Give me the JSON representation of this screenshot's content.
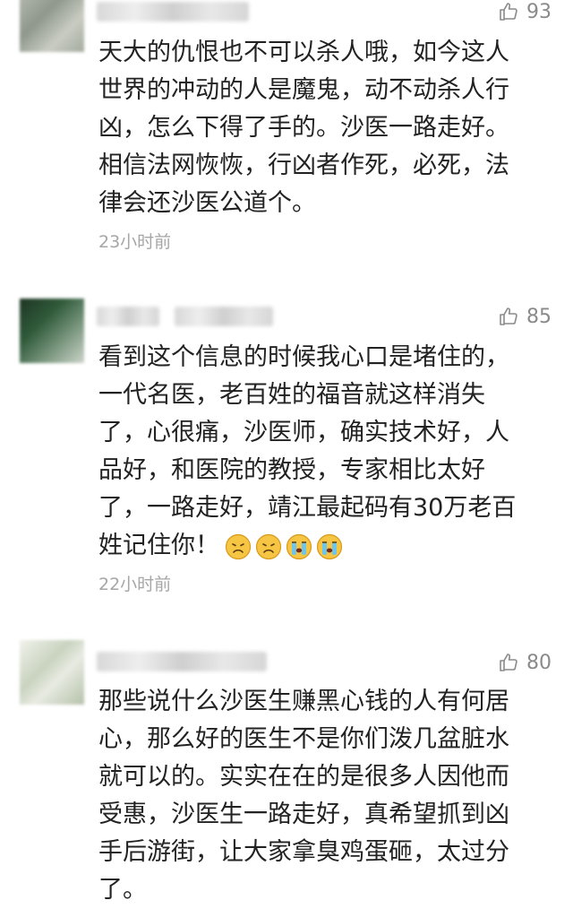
{
  "comments": [
    {
      "likes": "93",
      "text": "天大的仇恨也不可以杀人哦，如今这人\n世界的冲动的人是魔鬼，动不动杀人行\n凶，怎么下得了手的。沙医一路走好。\n相信法网恢恢，行凶者作死，必死，法\n律会还沙医公道个。",
      "time": "23小时前"
    },
    {
      "likes": "85",
      "text": "看到这个信息的时候我心口是堵住的，\n一代名医，老百姓的福音就这样消失\n了，心很痛，沙医师，确实技术好，人\n品好，和医院的教授，专家相比太好\n了，一路走好，靖江最起码有30万老百\n姓记住你！",
      "emojis": [
        "sad-face-emoji",
        "sad-face-emoji",
        "crying-face-emoji",
        "crying-face-emoji"
      ],
      "time": "22小时前"
    },
    {
      "likes": "80",
      "text": "那些说什么沙医生赚黑心钱的人有何居\n心，那么好的医生不是你们泼几盆脏水\n就可以的。实实在在的是很多人因他而\n受惠，沙医生一路走好，真希望抓到凶\n手后游街，让大家拿臭鸡蛋砸，太过分\n了。"
    }
  ],
  "colors": {
    "text": "#222222",
    "meta": "#a6a6a6",
    "like": "#8a8a8a"
  },
  "icons": {
    "like": "thumbs-up-icon"
  }
}
